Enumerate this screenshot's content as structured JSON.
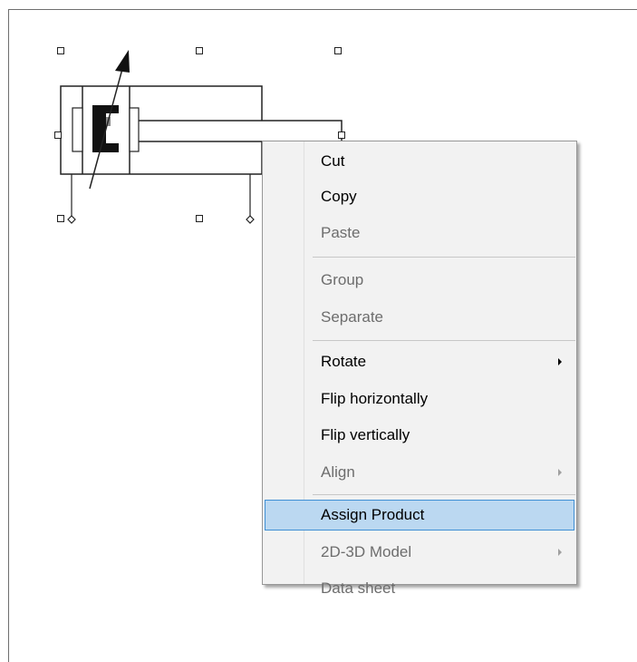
{
  "context_menu": {
    "items": [
      {
        "label": "Cut",
        "enabled": true
      },
      {
        "label": "Copy",
        "enabled": true
      },
      {
        "label": "Paste",
        "enabled": false
      },
      {
        "label": "Group",
        "enabled": false
      },
      {
        "label": "Separate",
        "enabled": false
      },
      {
        "label": "Rotate",
        "enabled": true,
        "submenu": true
      },
      {
        "label": "Flip horizontally",
        "enabled": true
      },
      {
        "label": "Flip vertically",
        "enabled": true
      },
      {
        "label": "Align",
        "enabled": false,
        "submenu": true
      },
      {
        "label": "Assign Product",
        "enabled": true,
        "highlighted": true
      },
      {
        "label": "2D-3D Model",
        "enabled": false,
        "submenu": true
      },
      {
        "label": "Data sheet",
        "enabled": false
      }
    ]
  },
  "colors": {
    "highlight_bg": "#bbd8f1",
    "highlight_border": "#3f8fd5",
    "disabled_text": "#6d6d6d",
    "menu_bg": "#f2f2f2"
  },
  "canvas": {
    "selected_symbol": "pneumatic-cylinder-icon"
  }
}
